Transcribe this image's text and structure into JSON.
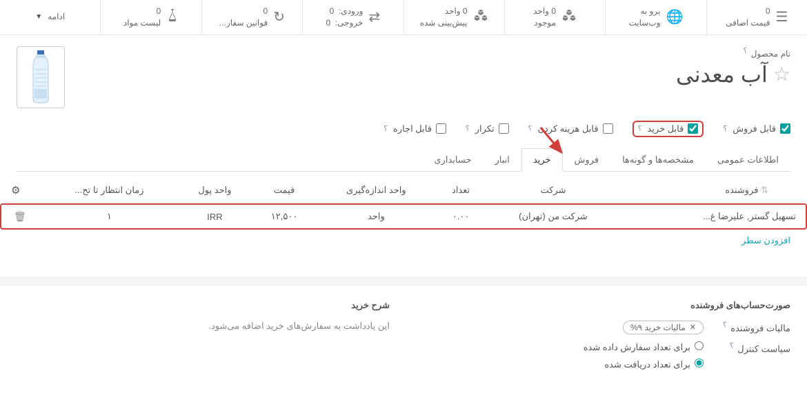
{
  "stats": {
    "extra_price_v": "0",
    "extra_price_l": "قیمت اضافی",
    "website_v": "برو به",
    "website_l": "وب‌سایت",
    "onhand_v": "0 واحد",
    "onhand_l": "موجود",
    "forecast_v": "0 واحد",
    "forecast_l": "پیش‌بینی شده",
    "in_v": "ورودی:",
    "in_n": "0",
    "out_v": "خروجی:",
    "out_n": "0",
    "rules_v": "0",
    "rules_l": "قوانین سفار...",
    "bom_v": "0",
    "bom_l": "لیست مواد",
    "more": "ادامه"
  },
  "product": {
    "name_label": "نام محصول",
    "title": "آب معدنی"
  },
  "checks": {
    "can_sell": "قابل فروش",
    "can_buy": "قابل خرید",
    "can_expense": "قابل هزینه کردن",
    "recurring": "تکرار",
    "rentable": "قابل اجاره"
  },
  "tabs": {
    "general": "اطلاعات عمومی",
    "variants": "مشخصه‌ها و گونه‌ها",
    "sales": "فروش",
    "purchase": "خرید",
    "inventory": "انبار",
    "accounting": "حسابداری"
  },
  "table": {
    "h_vendor": "فروشنده",
    "h_company": "شرکت",
    "h_qty": "تعداد",
    "h_uom": "واحد اندازه‌گیری",
    "h_price": "قیمت",
    "h_currency": "واحد پول",
    "h_lead": "زمان انتظار تا تح...",
    "r_vendor": "تسهیل گستر, علیرضا غ...",
    "r_company": "شرکت من (تهران)",
    "r_qty": "۰.۰۰",
    "r_uom": "واحد",
    "r_price": "۱۲,۵۰۰",
    "r_currency": "IRR",
    "r_lead": "۱",
    "add_line": "افزودن سطر"
  },
  "bottom": {
    "bills_title": "صورت‌حساب‌های فروشنده",
    "vendor_tax_lbl": "مالیات فروشنده",
    "vendor_tax_tag": "مالیات خرید ۹%",
    "control_lbl": "سیاست کنترل",
    "ordered": "برای تعداد سفارش داده شده",
    "received": "برای تعداد دریافت شده",
    "purchase_desc_title": "شرح خرید",
    "purchase_desc_text": "این یادداشت به سفارش‌های خرید اضافه می‌شود."
  }
}
